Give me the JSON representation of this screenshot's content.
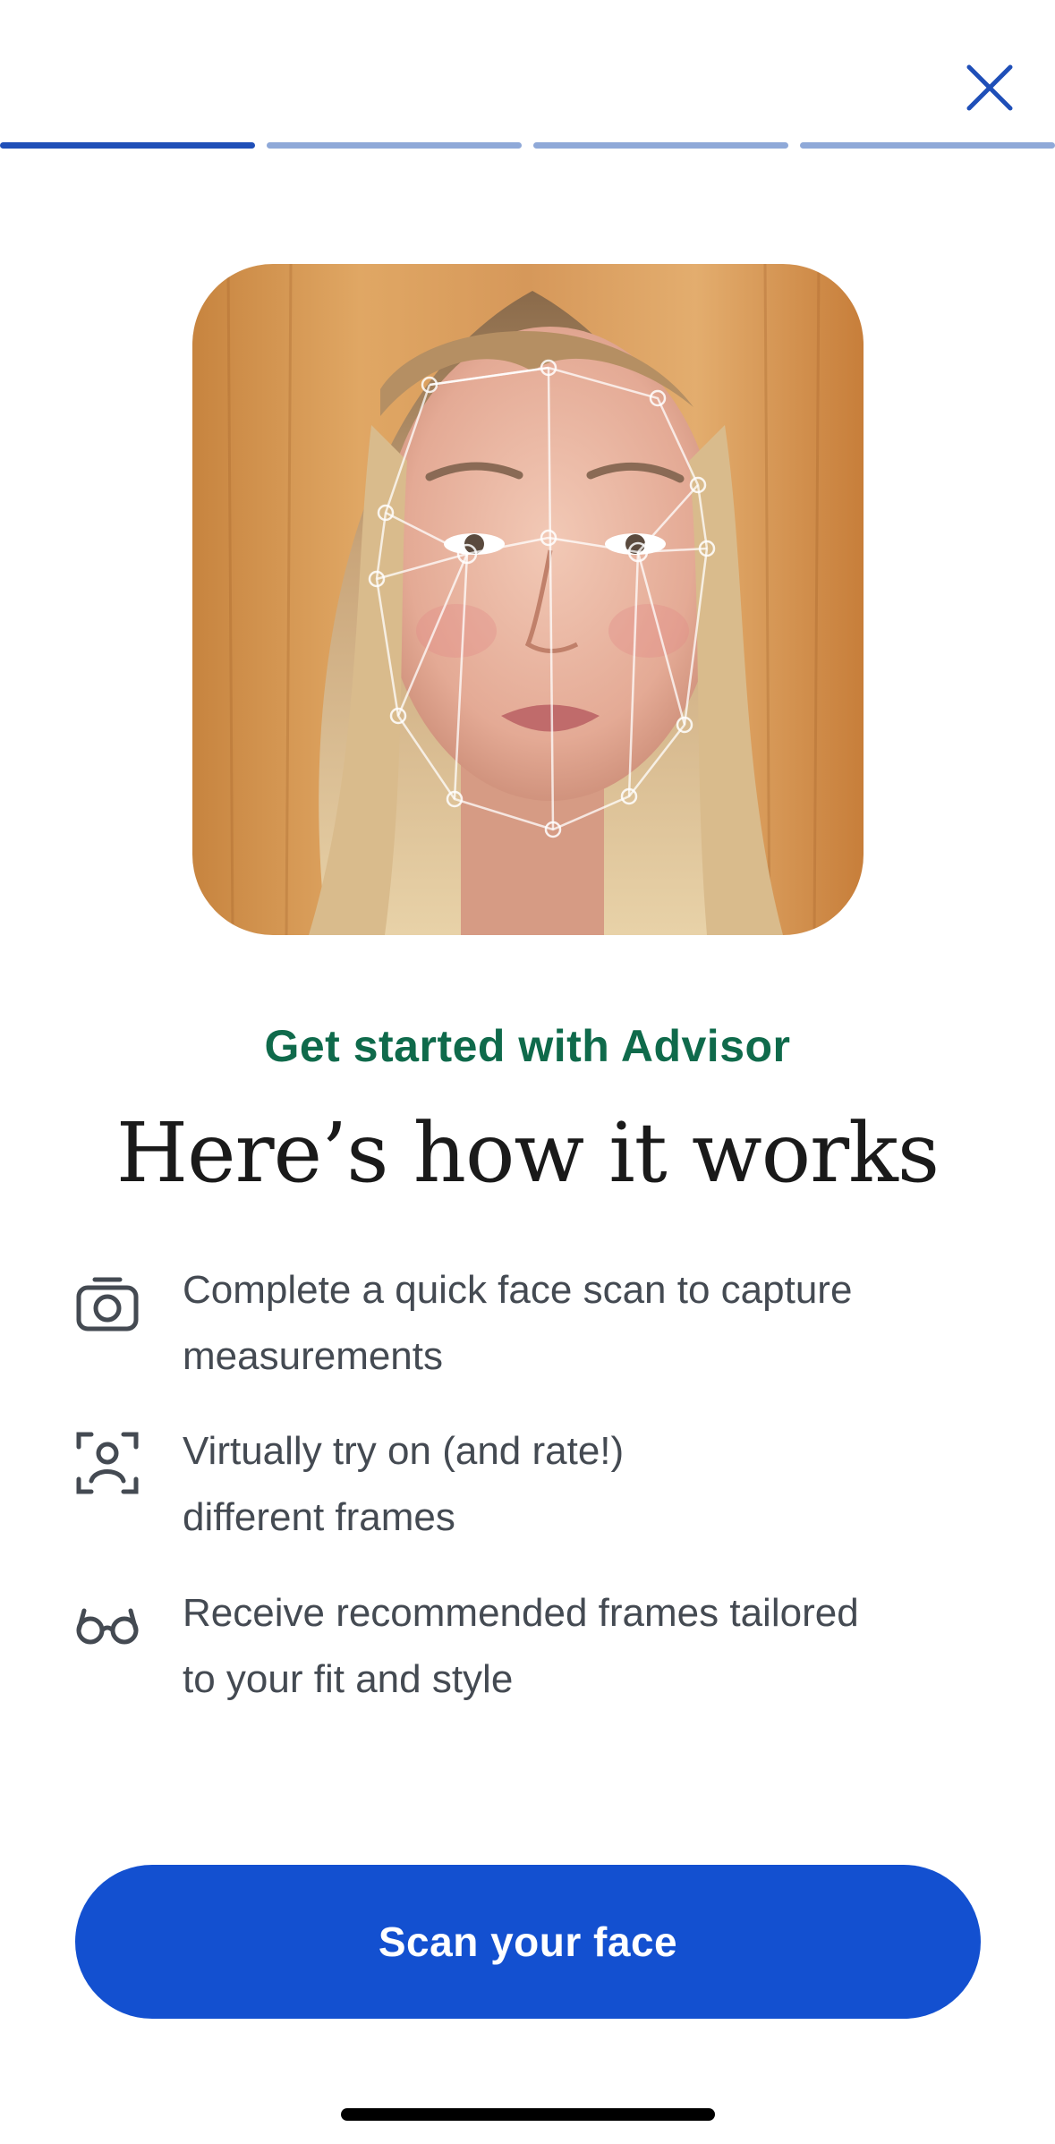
{
  "header": {
    "close_icon": "close-icon",
    "progress": {
      "total_steps": 4,
      "current_step": 1
    }
  },
  "hero": {
    "image_description_icon": "face-scan-photo"
  },
  "content": {
    "eyebrow": "Get started with Advisor",
    "headline": "Here’s how it works",
    "steps": [
      {
        "icon": "camera-icon",
        "line1": "Complete a quick face scan to capture",
        "line2": "measurements"
      },
      {
        "icon": "face-scan-icon",
        "line1": "Virtually try on (and rate!)",
        "line2": "different frames"
      },
      {
        "icon": "glasses-icon",
        "line1": "Receive recommended frames tailored",
        "line2": "to your fit and style"
      }
    ]
  },
  "cta": {
    "label": "Scan your face"
  },
  "colors": {
    "accent": "#1350d0",
    "progress_active": "#1f4fb8",
    "progress_inactive": "#8fa9d8",
    "eyebrow": "#0f6a4b",
    "body_text": "#444a52"
  }
}
